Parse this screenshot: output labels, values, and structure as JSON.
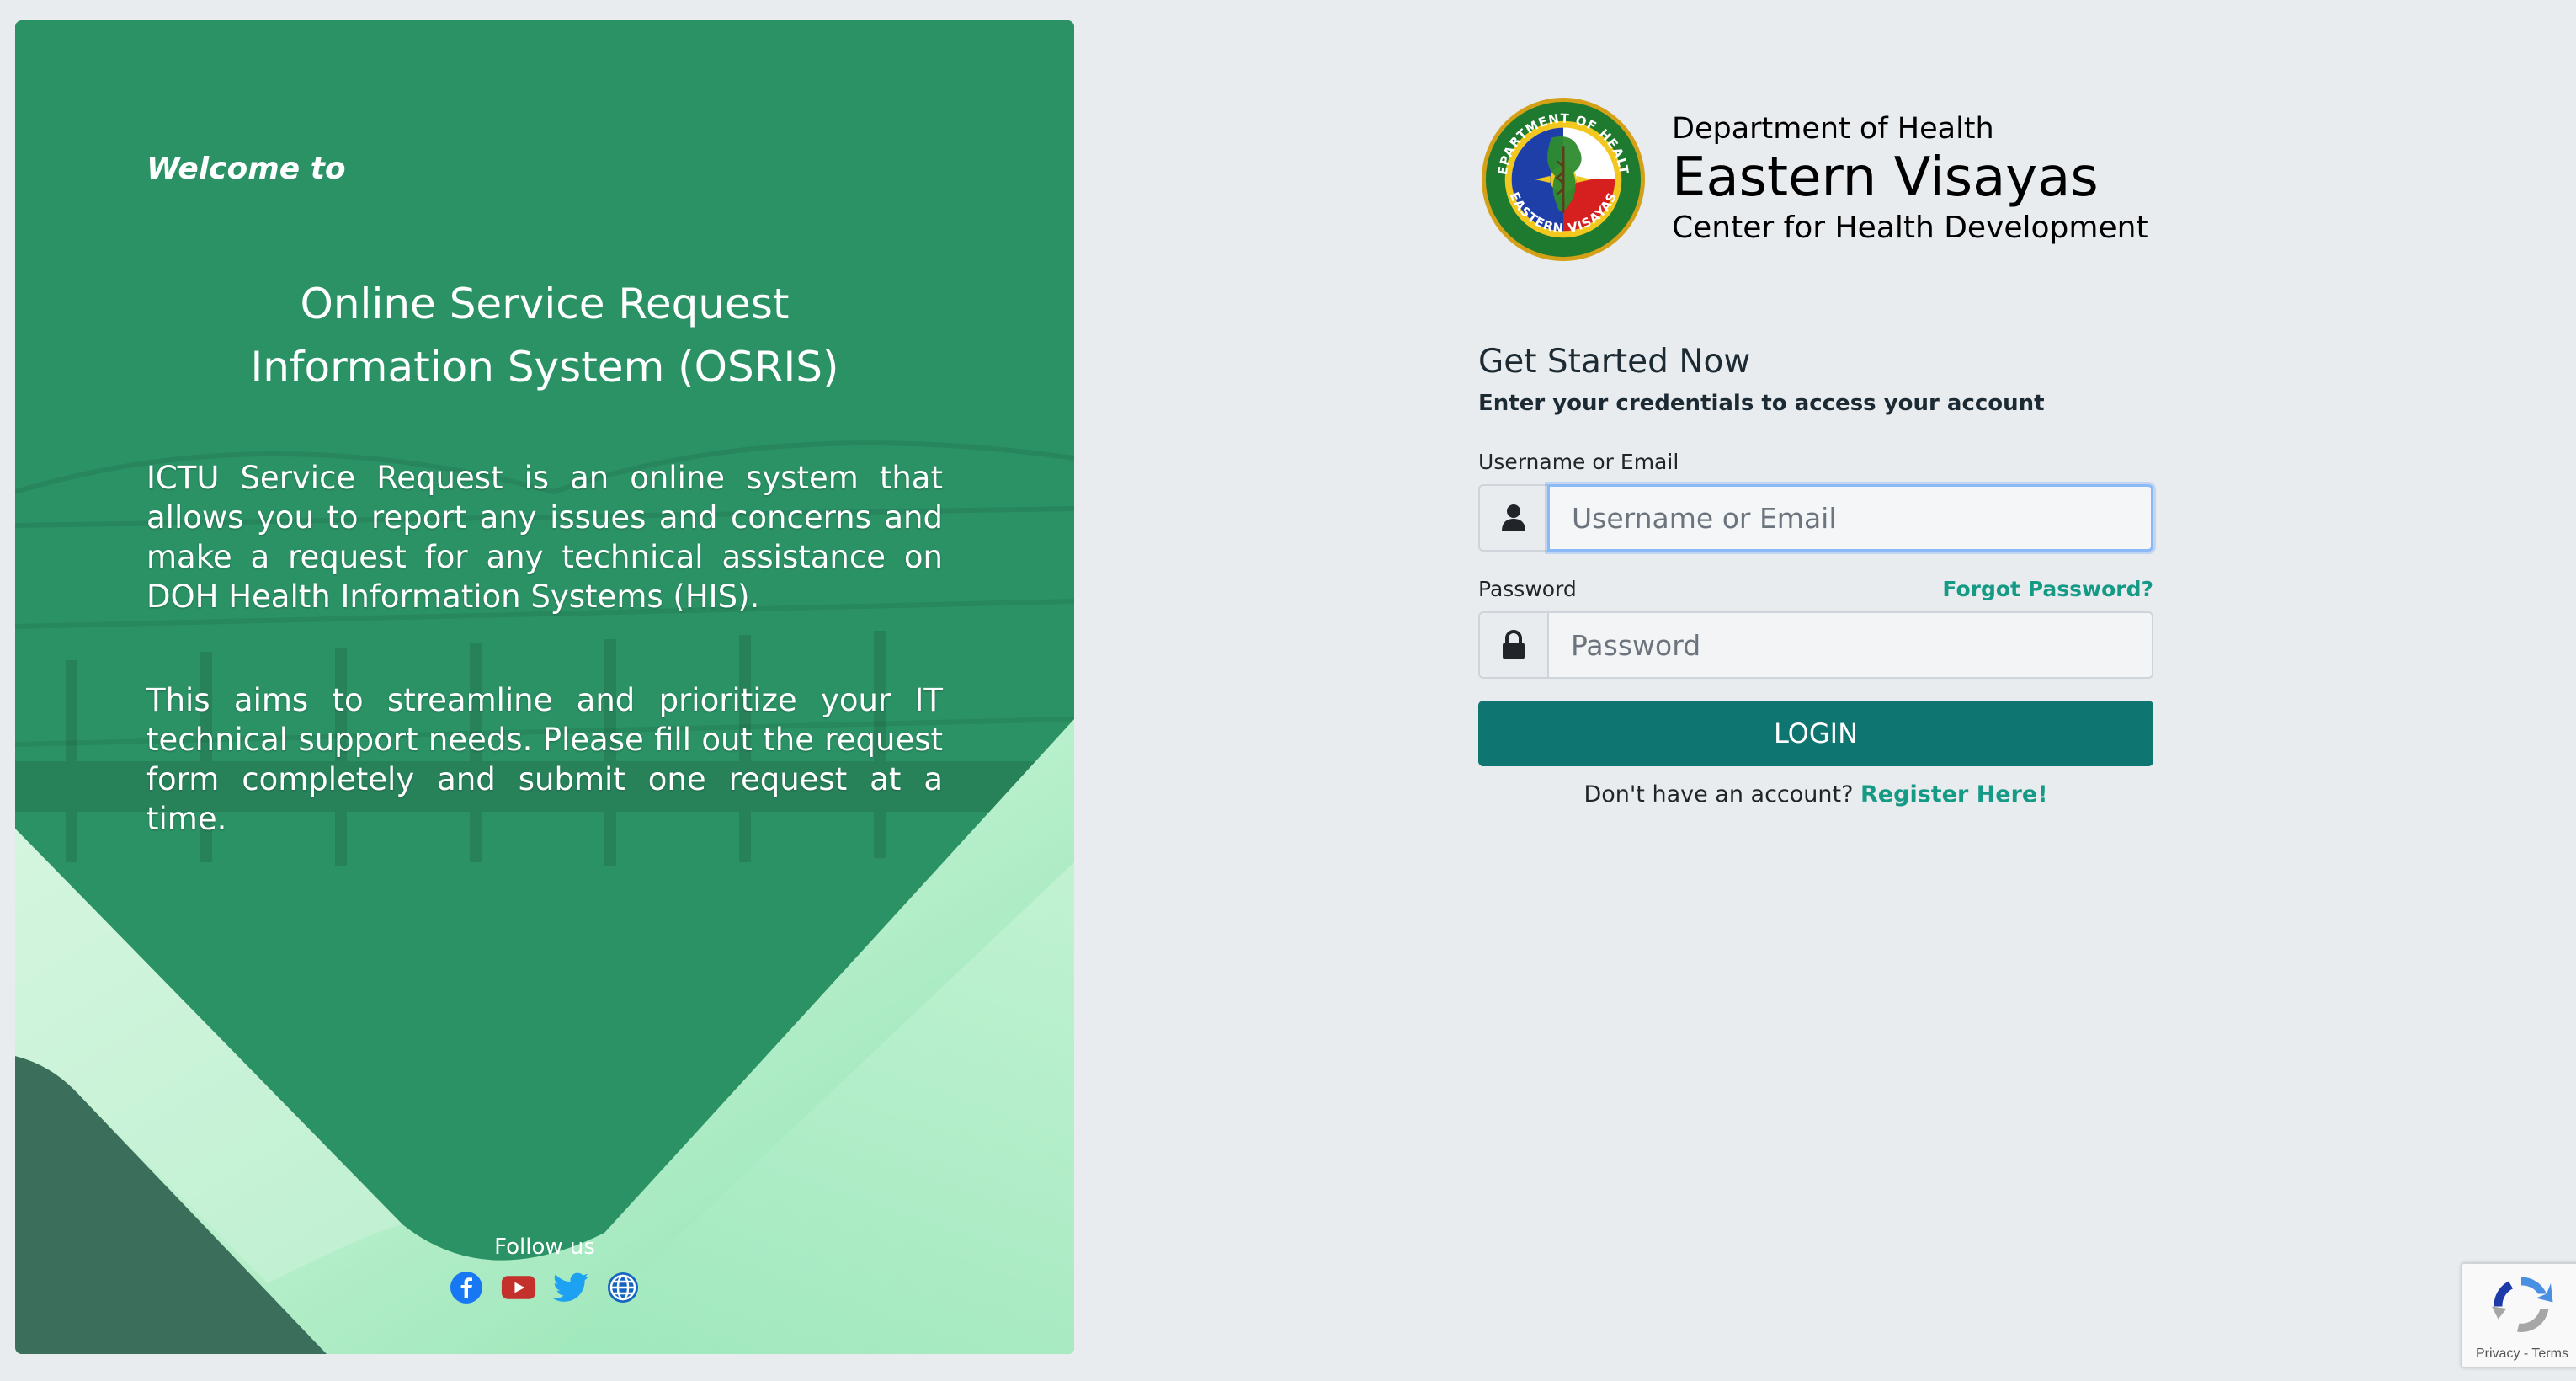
{
  "left_panel": {
    "welcome": "Welcome to",
    "title_line1": "Online Service Request",
    "title_line2": "Information System (OSRIS)",
    "description_1": "ICTU Service Request is an online system that allows you to report any issues and concerns and make a request for any technical assistance on DOH Health Information Systems (HIS).",
    "description_2": "This aims to streamline and prioritize your IT technical support needs. Please fill out the request form completely and submit one request at a time.",
    "follow_us": "Follow us",
    "social_icons": [
      "facebook-icon",
      "youtube-icon",
      "twitter-icon",
      "globe-icon"
    ],
    "colors": {
      "panel_green": "#2b9265",
      "light_green": "#a8ecc6"
    }
  },
  "header": {
    "seal_top_text": "DEPARTMENT OF HEALTH",
    "seal_bottom_text": "EASTERN VISAYAS",
    "line1": "Department of Health",
    "line2": "Eastern Visayas",
    "line3": "Center for Health Development"
  },
  "form": {
    "heading": "Get Started Now",
    "subtitle": "Enter your credentials to access your account",
    "username_label": "Username or Email",
    "username_placeholder": "Username or Email",
    "username_value": "",
    "password_label": "Password",
    "forgot_password": "Forgot Password?",
    "password_placeholder": "Password",
    "password_value": "",
    "login_button": "LOGIN",
    "no_account_text": "Don't have an account?",
    "register_link": "Register Here!",
    "colors": {
      "primary": "#0e7570",
      "link": "#159a86"
    }
  },
  "recaptcha": {
    "privacy_terms": "Privacy - Terms"
  }
}
